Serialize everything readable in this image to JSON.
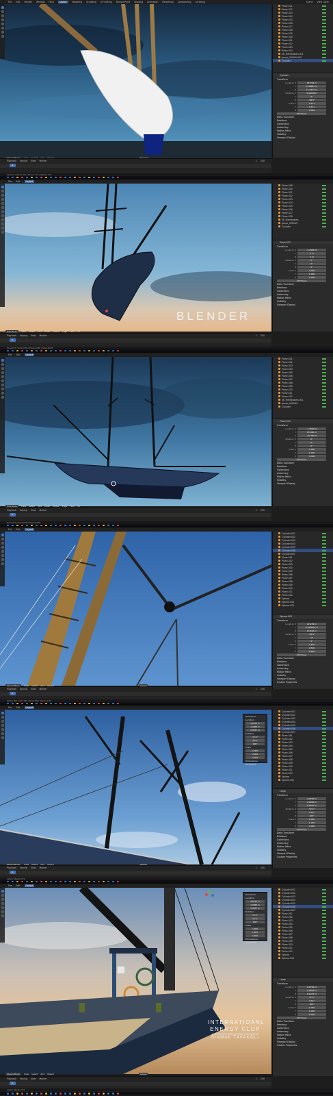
{
  "app": {
    "menu": [
      "File",
      "Edit",
      "Render",
      "Window",
      "Help"
    ],
    "workspaces": [
      "Layout",
      "Modeling",
      "Sculpting",
      "UV Editing",
      "Texture Paint",
      "Shading",
      "Animation",
      "Rendering",
      "Compositing",
      "Scripting"
    ],
    "active_workspace": "Layout",
    "scene_label": "Scene",
    "view_layer_label": "View Layer"
  },
  "panels": [
    {
      "viewport_header": {
        "mode": "Object Mode",
        "menus": [
          "View",
          "Select",
          "Add",
          "Object"
        ],
        "shading": "Normal"
      },
      "outliner": {
        "rows": [
          "Plane.011",
          "Plane.012",
          "Plane.013",
          "Plane.014",
          "Plane.015",
          "Plane.016",
          "Plane.017",
          "Plane.018",
          "Plane.019",
          "Plane.020",
          "Plane.021",
          "Plane.022",
          "Plane.023",
          "Plane.024",
          "SK_Riemkasten.001",
          "group_000049.001",
          "Cylinder"
        ],
        "selected": 16
      },
      "properties": {
        "object": "Cylinder",
        "section": "Transform",
        "fields": [
          [
            "Location X",
            "25.793 m"
          ],
          [
            "Y",
            "2.58685 m"
          ],
          [
            "Z",
            "11.5125 m"
          ],
          [
            "Rotation X",
            "-0.000001°"
          ],
          [
            "Y",
            "0°"
          ],
          [
            "Z",
            "-94.5°"
          ],
          [
            "Scale X",
            "0.111"
          ],
          [
            "Y",
            "0.111"
          ],
          [
            "Z",
            "2.000"
          ]
        ],
        "rotation_mode": "XYZ Euler",
        "extra_sections": [
          "Delta Transform",
          "Relations",
          "Collections",
          "Instancing",
          "Motion Paths",
          "Visibility",
          "Viewport Display"
        ]
      },
      "timeline": {
        "controls": [
          "Playback",
          "Keying",
          "View",
          "Marker"
        ],
        "frame": "1",
        "start": "1",
        "end": "250"
      },
      "status": "Cylinder | Verts:1,432 | Faces:1,374 | Objects:1/76"
    },
    {
      "viewport_header": {
        "mode": "Edit Mode",
        "menus": [
          "View",
          "Select",
          "Add",
          "Mesh",
          "Vertex",
          "Edge",
          "Face",
          "UV"
        ],
        "shading": "Normal"
      },
      "outliner": {
        "rows": [
          "Plane.009",
          "Plane.010",
          "Plane.011",
          "Plane.012",
          "Plane.013",
          "Plane.014",
          "Plane.015",
          "Plane.016",
          "Plane.017",
          "Plane.018",
          "SK_Riemkasten",
          "group_000049",
          "Cylinder"
        ],
        "selected": -1
      },
      "properties": {
        "object": "Plane.013",
        "section": "Transform",
        "fields": [
          [
            "Location X",
            "-1.4566 m"
          ],
          [
            "Y",
            "0 m"
          ],
          [
            "Z",
            "0 m"
          ],
          [
            "Rotation X",
            "0°"
          ],
          [
            "Y",
            "0°"
          ],
          [
            "Z",
            "0°"
          ],
          [
            "Scale X",
            "1.000"
          ],
          [
            "Y",
            "1.000"
          ],
          [
            "Z",
            "1.000"
          ]
        ],
        "rotation_mode": "XYZ Euler",
        "extra_sections": [
          "Delta Transform",
          "Relations",
          "Collections",
          "Instancing",
          "Motion Paths",
          "Visibility",
          "Viewport Display"
        ]
      },
      "timeline": {
        "controls": [
          "Playback",
          "Keying",
          "View",
          "Marker"
        ],
        "frame": "1",
        "start": "1",
        "end": "250"
      },
      "status": "Plane.013 | Verts:0/284 | Edges:0/560 | Faces:0/278"
    },
    {
      "viewport_header": {
        "mode": "Edit Mode",
        "menus": [
          "View",
          "Select",
          "Add",
          "Mesh",
          "Vertex",
          "Edge",
          "Face",
          "UV"
        ],
        "shading": "Normal"
      },
      "outliner": {
        "rows": [
          "Plane.001",
          "Plane.002",
          "Plane.003",
          "Plane.004",
          "Plane.005",
          "Plane.006",
          "Plane.007",
          "Plane.008",
          "Plane.009",
          "Plane.010",
          "Plane.011",
          "Plane.012",
          "SK_Riemkasten.001",
          "group_000049",
          "Cylinder"
        ],
        "selected": -1
      },
      "properties": {
        "object": "Plane.013",
        "section": "Transform",
        "fields": [
          [
            "Location X",
            "-1.4566 m"
          ],
          [
            "Y",
            "25.086 m"
          ],
          [
            "Z",
            "-25.089 m"
          ],
          [
            "Rotation X",
            "0°"
          ],
          [
            "Y",
            "0°"
          ],
          [
            "Z",
            "0°"
          ],
          [
            "Scale X",
            "1.000"
          ],
          [
            "Y",
            "1.000"
          ],
          [
            "Z",
            "1.000"
          ]
        ],
        "rotation_mode": "XYZ Euler",
        "extra_sections": [
          "Delta Transform",
          "Relations",
          "Collections",
          "Instancing",
          "Motion Paths",
          "Visibility",
          "Viewport Display"
        ]
      },
      "timeline": {
        "controls": [
          "Playback",
          "Keying",
          "View",
          "Marker"
        ],
        "frame": "1",
        "start": "1",
        "end": "250"
      },
      "status": "Plane.013 | Verts:0/284 | Edges:0/560"
    },
    {
      "viewport_header": {
        "mode": "Object Mode",
        "menus": [
          "View",
          "Select",
          "Add",
          "Object"
        ],
        "shading": "Global"
      },
      "outliner": {
        "rows": [
          "Cylinder.001",
          "Cylinder.002",
          "Cylinder.003",
          "Cylinder.004",
          "Cylinder.005",
          "Cylinder.006",
          "Cylinder.007",
          "Plane.001",
          "Plane.002",
          "Plane.003",
          "Plane.004",
          "Plane.005",
          "Plane.006",
          "Plane.007",
          "Plane.008",
          "Plane.009",
          "Plane.010",
          "Plane.011",
          "Plane.012",
          "Sphere",
          "Sphere.001",
          "Sphere.002"
        ],
        "selected": 5
      },
      "properties": {
        "object": "Sphere.002",
        "section": "Transform",
        "fields": [
          [
            "Location X",
            "22.234 m"
          ],
          [
            "Y",
            "0.000000 m"
          ],
          [
            "Z",
            "14.834 m"
          ],
          [
            "Rotation X",
            "-26.5°"
          ],
          [
            "Y",
            "-0°"
          ],
          [
            "Z",
            "0°"
          ],
          [
            "Scale X",
            "0.500"
          ],
          [
            "Y",
            "0.500"
          ],
          [
            "Z",
            "0.500"
          ]
        ],
        "rotation_mode": "XYZ Euler",
        "extra_sections": [
          "Delta Transform",
          "Relations",
          "Collections",
          "Instancing",
          "Motion Paths",
          "Visibility",
          "Viewport Display",
          "Custom Properties"
        ]
      },
      "timeline": {
        "controls": [
          "Playback",
          "Keying",
          "View",
          "Marker"
        ],
        "frame": "1",
        "start": "1",
        "end": "250"
      },
      "status": "Sphere.002 | Verts:482 | Faces:480 | Objects:1/76"
    },
    {
      "viewport_header": {
        "mode": "Object Mode",
        "menus": [
          "View",
          "Select",
          "Add",
          "Object"
        ],
        "shading": "Global"
      },
      "outliner": {
        "rows": [
          "Cylinder.001",
          "Cylinder.002",
          "Cylinder.003",
          "Cylinder.004",
          "Cylinder.005",
          "Cylinder.006",
          "Cylinder.007",
          "Plane.001",
          "Plane.002",
          "Plane.003",
          "Plane.004",
          "Plane.005",
          "Plane.006",
          "Plane.007",
          "Plane.008",
          "Plane.009",
          "Plane.010",
          "Plane.011",
          "Plane.012",
          "Sphere",
          "Sphere.001"
        ],
        "selected": 5
      },
      "properties": {
        "object": "Lamp",
        "section": "Transform",
        "fields": [
          [
            "Location X",
            "4.0756 m"
          ],
          [
            "Y",
            "1.0058 m"
          ],
          [
            "Z",
            "5.9037 m"
          ],
          [
            "Rotation X",
            "37.3°"
          ],
          [
            "Y",
            "3.16°"
          ],
          [
            "Z",
            "106°"
          ],
          [
            "Scale X",
            "1.000"
          ],
          [
            "Y",
            "1.000"
          ],
          [
            "Z",
            "1.000"
          ]
        ],
        "rotation_mode": "XYZ Euler",
        "extra_sections": [
          "Delta Transform",
          "Relations",
          "Collections",
          "Instancing",
          "Motion Paths",
          "Visibility",
          "Viewport Display",
          "Custom Properties"
        ]
      },
      "n_panel": {
        "sections": [
          "Transform",
          "Location",
          "Rotation",
          "Scale",
          "Dimensions",
          "Properties"
        ],
        "values": [
          "4.0756 m",
          "1.0058 m",
          "5.9037 m",
          "37.3°",
          "3.16°",
          "106°",
          "1.000",
          "1.000",
          "1.000"
        ]
      },
      "timeline": {
        "controls": [
          "Playback",
          "Keying",
          "View",
          "Marker"
        ],
        "frame": "1",
        "start": "1",
        "end": "250"
      },
      "status": "Lamp | Objects:1/76"
    },
    {
      "viewport_header": {
        "mode": "Object Mode",
        "menus": [
          "View",
          "Select",
          "Add",
          "Object"
        ],
        "shading": "Global"
      },
      "outliner": {
        "rows": [
          "Cylinder.001",
          "Cylinder.002",
          "Cylinder.003",
          "Cylinder.004",
          "Cylinder.005",
          "Cylinder.006",
          "Cylinder.007",
          "Plane.001",
          "Plane.002",
          "Plane.003",
          "Plane.004",
          "Plane.005",
          "Plane.006",
          "Plane.007",
          "Plane.008",
          "Plane.009",
          "Plane.010",
          "Plane.011",
          "Plane.012",
          "Sphere",
          "Sphere.001"
        ],
        "selected": 5
      },
      "properties": {
        "object": "Lamp",
        "section": "Transform",
        "fields": [
          [
            "Location X",
            "4.0756 m"
          ],
          [
            "Y",
            "1.0058 m"
          ],
          [
            "Z",
            "5.9037 m"
          ],
          [
            "Rotation X",
            "37.3°"
          ],
          [
            "Y",
            "3.16°"
          ],
          [
            "Z",
            "106°"
          ],
          [
            "Scale X",
            "1.000"
          ],
          [
            "Y",
            "1.000"
          ],
          [
            "Z",
            "1.000"
          ]
        ],
        "rotation_mode": "XYZ Euler",
        "extra_sections": [
          "Delta Transform",
          "Relations",
          "Collections",
          "Instancing",
          "Motion Paths",
          "Visibility",
          "Viewport Display",
          "Custom Properties"
        ]
      },
      "n_panel": {
        "sections": [
          "Transform",
          "Location",
          "Rotation",
          "Scale",
          "Dimensions",
          "Properties"
        ],
        "values": [
          "4.0756 m",
          "1.0058 m",
          "5.9037 m",
          "37.3°",
          "3.16°",
          "106°",
          "1.000",
          "1.000",
          "1.000"
        ]
      },
      "timeline": {
        "controls": [
          "Playback",
          "Keying",
          "View",
          "Marker"
        ],
        "frame": "1",
        "start": "1",
        "end": "250"
      },
      "status": "Lamp | Objects:1/76"
    }
  ],
  "overlays": {
    "blender_title": "BLENDER",
    "club_line1": "INTERNATIOANL",
    "club_line2": "ENERGY CLUP",
    "author": "SIAMAK TAVAKOLI"
  },
  "colors": {
    "accent": "#4772b3",
    "outliner_selection": "#334d80",
    "object_orange": "#e59a3a",
    "visibility_green": "#4caf50"
  }
}
